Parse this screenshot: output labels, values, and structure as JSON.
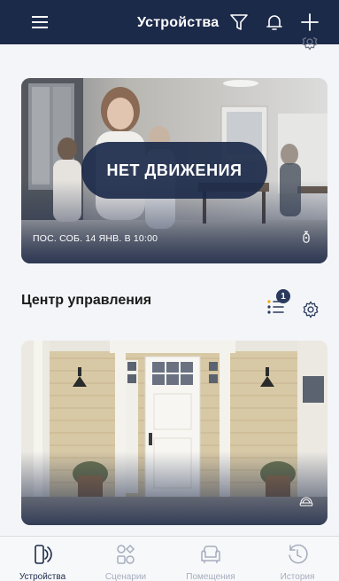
{
  "header": {
    "title": "Устройства"
  },
  "camera_card": {
    "status_overlay": "НЕТ ДВИЖЕНИЯ",
    "last_event": "ПОС. СОБ. 14 ЯНВ. В 10:00"
  },
  "section": {
    "title": "Центр управления",
    "badge_count": "1"
  },
  "tabbar": {
    "items": [
      {
        "label": "Устройства",
        "icon": "devices-icon",
        "active": true
      },
      {
        "label": "Сценарии",
        "icon": "scenarios-icon",
        "active": false
      },
      {
        "label": "Помещения",
        "icon": "rooms-icon",
        "active": false
      },
      {
        "label": "История",
        "icon": "history-icon",
        "active": false
      }
    ]
  },
  "colors": {
    "header_bg": "#1c2a4a",
    "overlay_bg": "#1c2a4a",
    "tab_active": "#1c2a4a",
    "tab_inactive": "#a5adbd"
  }
}
